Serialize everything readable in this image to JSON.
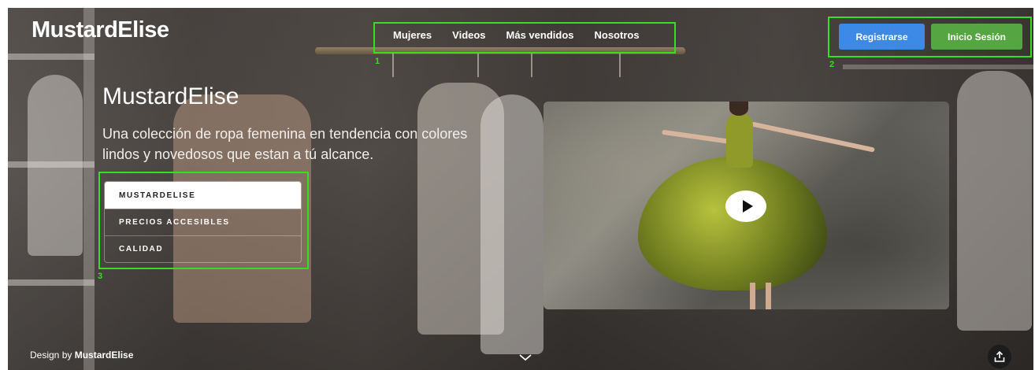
{
  "brand": {
    "logo": "MustardElise"
  },
  "nav": {
    "items": [
      "Mujeres",
      "Videos",
      "Más vendidos",
      "Nosotros"
    ]
  },
  "auth": {
    "register_label": "Registrarse",
    "login_label": "Inicio Sesión",
    "register_color": "#3d8ae6",
    "login_color": "#55a643"
  },
  "hero": {
    "title": "MustardElise",
    "description": "Una colección de ropa femenina en tendencia con colores lindos y novedosos que estan a tú alcance."
  },
  "tabs": {
    "items": [
      "MUSTARDELISE",
      "PRECIOS ACCESIBLES",
      "CALIDAD"
    ],
    "active_index": 0
  },
  "video": {
    "play_icon": "play-icon"
  },
  "footer": {
    "credit_prefix": "Design by ",
    "credit_name": "MustardElise"
  },
  "annotations": {
    "labels": [
      "1",
      "2",
      "3"
    ],
    "color": "#35e01f"
  },
  "icons": {
    "scroll": "chevron-down-icon",
    "share": "share-icon"
  }
}
